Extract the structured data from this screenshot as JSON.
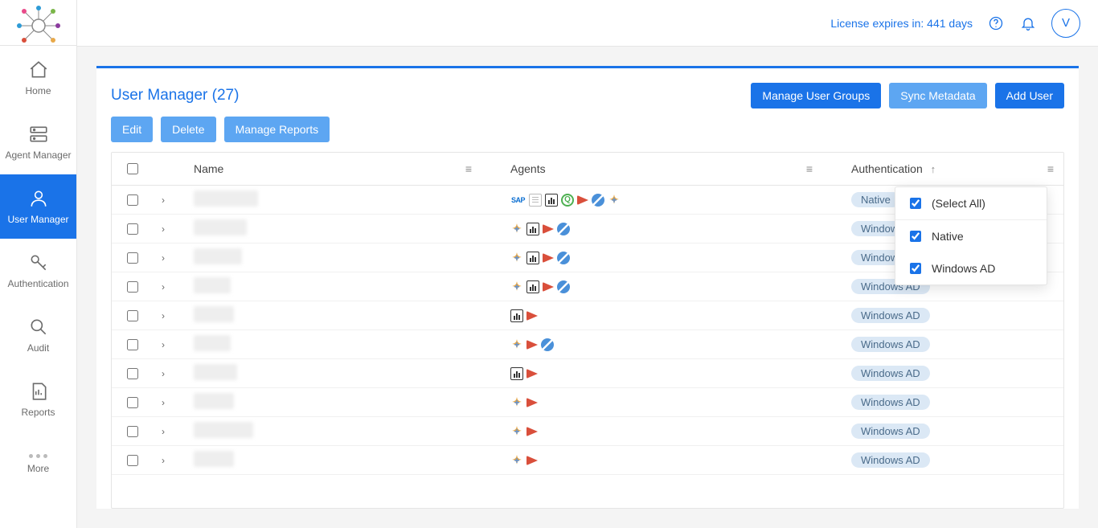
{
  "sidebar": {
    "items": [
      {
        "label": "Home"
      },
      {
        "label": "Agent Manager"
      },
      {
        "label": "User Manager"
      },
      {
        "label": "Authentication"
      },
      {
        "label": "Audit"
      },
      {
        "label": "Reports"
      }
    ],
    "more_label": "More"
  },
  "topbar": {
    "license": "License expires in: 441 days",
    "avatar_initial": "V"
  },
  "page": {
    "title": "User Manager (27)",
    "header_buttons": {
      "manage_groups": "Manage User Groups",
      "sync_metadata": "Sync Metadata",
      "add_user": "Add User"
    },
    "toolbar": {
      "edit": "Edit",
      "delete": "Delete",
      "manage_reports": "Manage Reports"
    }
  },
  "table": {
    "columns": {
      "name": "Name",
      "agents": "Agents",
      "authentication": "Authentication"
    },
    "rows": [
      {
        "name_width": 80,
        "agents": [
          "sap",
          "doc",
          "chart",
          "q",
          "red",
          "blue",
          "plus"
        ],
        "auth": "Native"
      },
      {
        "name_width": 66,
        "agents": [
          "plus",
          "chart",
          "red",
          "blue"
        ],
        "auth": "Windows AD"
      },
      {
        "name_width": 60,
        "agents": [
          "plus",
          "chart",
          "red",
          "blue"
        ],
        "auth": "Windows AD"
      },
      {
        "name_width": 46,
        "agents": [
          "plus",
          "chart",
          "red",
          "blue"
        ],
        "auth": "Windows AD"
      },
      {
        "name_width": 50,
        "agents": [
          "chart",
          "red"
        ],
        "auth": "Windows AD"
      },
      {
        "name_width": 46,
        "agents": [
          "plus",
          "red",
          "blue"
        ],
        "auth": "Windows AD"
      },
      {
        "name_width": 54,
        "agents": [
          "chart",
          "red"
        ],
        "auth": "Windows AD"
      },
      {
        "name_width": 50,
        "agents": [
          "plus",
          "red"
        ],
        "auth": "Windows AD"
      },
      {
        "name_width": 74,
        "agents": [
          "plus",
          "red"
        ],
        "auth": "Windows AD"
      },
      {
        "name_width": 50,
        "agents": [
          "plus",
          "red"
        ],
        "auth": "Windows AD"
      }
    ]
  },
  "filter_popover": {
    "select_all": "(Select All)",
    "options": [
      {
        "label": "Native",
        "checked": true
      },
      {
        "label": "Windows AD",
        "checked": true
      }
    ]
  }
}
